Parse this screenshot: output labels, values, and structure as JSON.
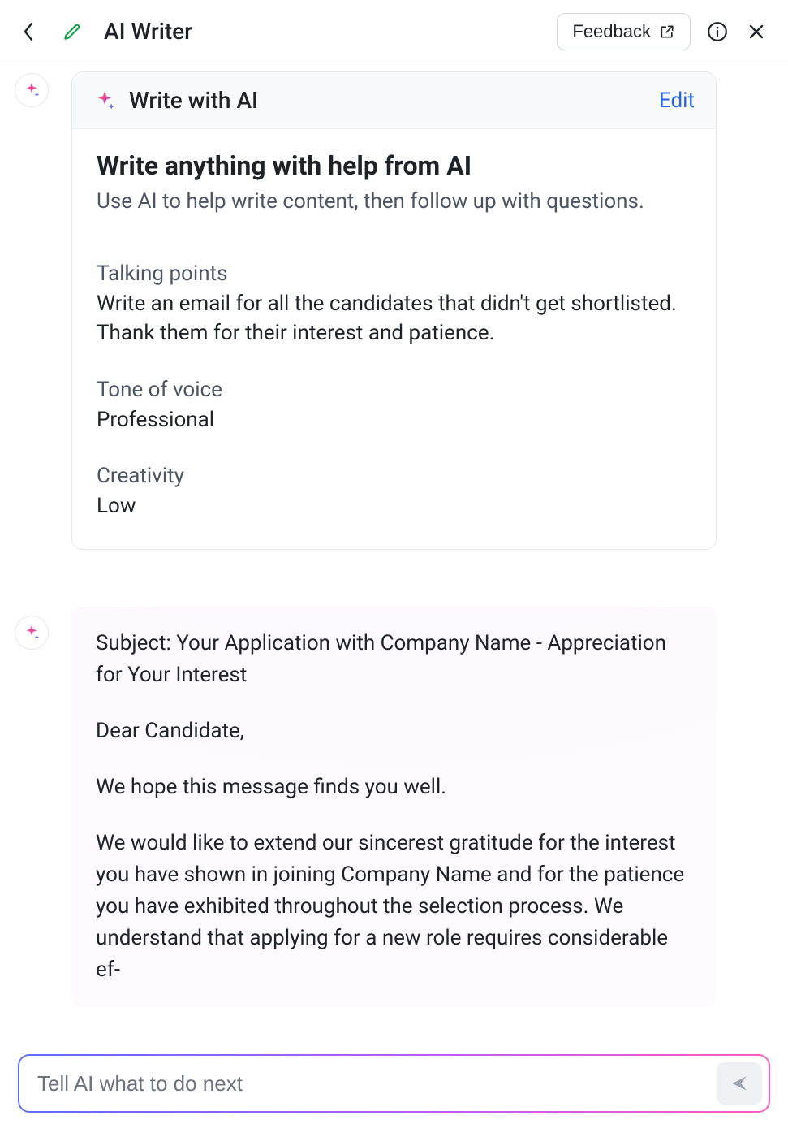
{
  "top": {
    "title": "AI Writer",
    "feedback": "Feedback"
  },
  "prompt": {
    "header": "Write with AI",
    "edit": "Edit",
    "title": "Write anything with help from AI",
    "subtitle": "Use AI to help write content, then follow up with questions.",
    "talking_label": "Talking points",
    "talking_value": "Write an email for all the candidates that didn't get shortlisted. Thank them for their interest and patience.",
    "tone_label": "Tone of voice",
    "tone_value": "Professional",
    "creativity_label": "Creativity",
    "creativity_value": "Low"
  },
  "response": {
    "p1": "Subject: Your Application with Company Name - Appreciation for Your Interest",
    "p2": "Dear Candidate,",
    "p3": "We hope this message finds you well.",
    "p4": "We would like to extend our sincerest gratitude for the interest you have shown in joining Company Name and for the patience you have exhibited throughout the selection process. We understand that applying for a new role requires considerable ef-"
  },
  "input": {
    "placeholder": "Tell AI what to do next"
  }
}
